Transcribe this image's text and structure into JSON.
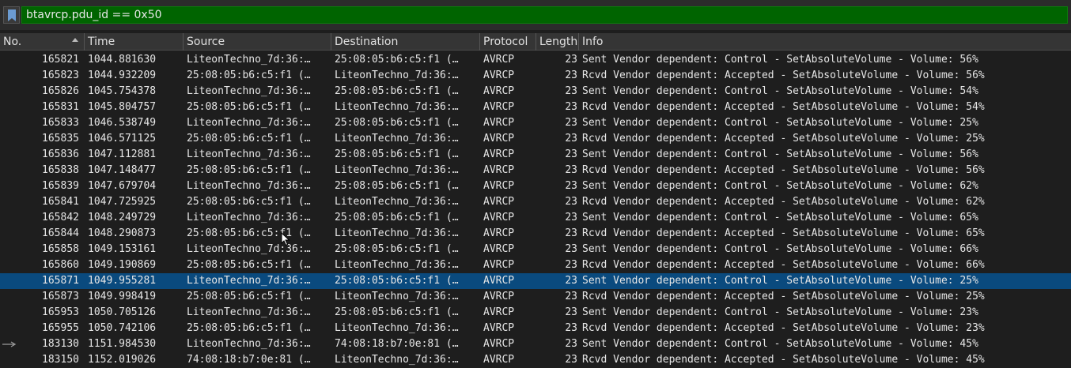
{
  "filter": {
    "value": "btavrcp.pdu_id == 0x50",
    "bookmark_icon": "bookmark-icon"
  },
  "columns": {
    "no": "No.",
    "time": "Time",
    "source": "Source",
    "destination": "Destination",
    "protocol": "Protocol",
    "length": "Length",
    "info": "Info"
  },
  "colors": {
    "filter_valid": "#006400",
    "selected_row": "#0a4a7e",
    "background": "#1e1e1e"
  },
  "packets": [
    {
      "no": "165821",
      "time": "1044.881630",
      "source": "LiteonTechno_7d:36:…",
      "destination": "25:08:05:b6:c5:f1 (…",
      "protocol": "AVRCP",
      "length": "23",
      "info": "Sent Vendor dependent: Control - SetAbsoluteVolume - Volume: 56%"
    },
    {
      "no": "165823",
      "time": "1044.932209",
      "source": "25:08:05:b6:c5:f1 (…",
      "destination": "LiteonTechno_7d:36:…",
      "protocol": "AVRCP",
      "length": "23",
      "info": "Rcvd Vendor dependent: Accepted - SetAbsoluteVolume - Volume: 56%"
    },
    {
      "no": "165826",
      "time": "1045.754378",
      "source": "LiteonTechno_7d:36:…",
      "destination": "25:08:05:b6:c5:f1 (…",
      "protocol": "AVRCP",
      "length": "23",
      "info": "Sent Vendor dependent: Control - SetAbsoluteVolume - Volume: 54%"
    },
    {
      "no": "165831",
      "time": "1045.804757",
      "source": "25:08:05:b6:c5:f1 (…",
      "destination": "LiteonTechno_7d:36:…",
      "protocol": "AVRCP",
      "length": "23",
      "info": "Rcvd Vendor dependent: Accepted - SetAbsoluteVolume - Volume: 54%"
    },
    {
      "no": "165833",
      "time": "1046.538749",
      "source": "LiteonTechno_7d:36:…",
      "destination": "25:08:05:b6:c5:f1 (…",
      "protocol": "AVRCP",
      "length": "23",
      "info": "Sent Vendor dependent: Control - SetAbsoluteVolume - Volume: 25%"
    },
    {
      "no": "165835",
      "time": "1046.571125",
      "source": "25:08:05:b6:c5:f1 (…",
      "destination": "LiteonTechno_7d:36:…",
      "protocol": "AVRCP",
      "length": "23",
      "info": "Rcvd Vendor dependent: Accepted - SetAbsoluteVolume - Volume: 25%"
    },
    {
      "no": "165836",
      "time": "1047.112881",
      "source": "LiteonTechno_7d:36:…",
      "destination": "25:08:05:b6:c5:f1 (…",
      "protocol": "AVRCP",
      "length": "23",
      "info": "Sent Vendor dependent: Control - SetAbsoluteVolume - Volume: 56%"
    },
    {
      "no": "165838",
      "time": "1047.148477",
      "source": "25:08:05:b6:c5:f1 (…",
      "destination": "LiteonTechno_7d:36:…",
      "protocol": "AVRCP",
      "length": "23",
      "info": "Rcvd Vendor dependent: Accepted - SetAbsoluteVolume - Volume: 56%"
    },
    {
      "no": "165839",
      "time": "1047.679704",
      "source": "LiteonTechno_7d:36:…",
      "destination": "25:08:05:b6:c5:f1 (…",
      "protocol": "AVRCP",
      "length": "23",
      "info": "Sent Vendor dependent: Control - SetAbsoluteVolume - Volume: 62%"
    },
    {
      "no": "165841",
      "time": "1047.725925",
      "source": "25:08:05:b6:c5:f1 (…",
      "destination": "LiteonTechno_7d:36:…",
      "protocol": "AVRCP",
      "length": "23",
      "info": "Rcvd Vendor dependent: Accepted - SetAbsoluteVolume - Volume: 62%"
    },
    {
      "no": "165842",
      "time": "1048.249729",
      "source": "LiteonTechno_7d:36:…",
      "destination": "25:08:05:b6:c5:f1 (…",
      "protocol": "AVRCP",
      "length": "23",
      "info": "Sent Vendor dependent: Control - SetAbsoluteVolume - Volume: 65%"
    },
    {
      "no": "165844",
      "time": "1048.290873",
      "source": "25:08:05:b6:c5:f1 (…",
      "destination": "LiteonTechno_7d:36:…",
      "protocol": "AVRCP",
      "length": "23",
      "info": "Rcvd Vendor dependent: Accepted - SetAbsoluteVolume - Volume: 65%"
    },
    {
      "no": "165858",
      "time": "1049.153161",
      "source": "LiteonTechno_7d:36:…",
      "destination": "25:08:05:b6:c5:f1 (…",
      "protocol": "AVRCP",
      "length": "23",
      "info": "Sent Vendor dependent: Control - SetAbsoluteVolume - Volume: 66%"
    },
    {
      "no": "165860",
      "time": "1049.190869",
      "source": "25:08:05:b6:c5:f1 (…",
      "destination": "LiteonTechno_7d:36:…",
      "protocol": "AVRCP",
      "length": "23",
      "info": "Rcvd Vendor dependent: Accepted - SetAbsoluteVolume - Volume: 66%"
    },
    {
      "no": "165871",
      "time": "1049.955281",
      "source": "LiteonTechno_7d:36:…",
      "destination": "25:08:05:b6:c5:f1 (…",
      "protocol": "AVRCP",
      "length": "23",
      "info": "Sent Vendor dependent: Control - SetAbsoluteVolume - Volume: 25%",
      "selected": true
    },
    {
      "no": "165873",
      "time": "1049.998419",
      "source": "25:08:05:b6:c5:f1 (…",
      "destination": "LiteonTechno_7d:36:…",
      "protocol": "AVRCP",
      "length": "23",
      "info": "Rcvd Vendor dependent: Accepted - SetAbsoluteVolume - Volume: 25%"
    },
    {
      "no": "165953",
      "time": "1050.705126",
      "source": "LiteonTechno_7d:36:…",
      "destination": "25:08:05:b6:c5:f1 (…",
      "protocol": "AVRCP",
      "length": "23",
      "info": "Sent Vendor dependent: Control - SetAbsoluteVolume - Volume: 23%"
    },
    {
      "no": "165955",
      "time": "1050.742106",
      "source": "25:08:05:b6:c5:f1 (…",
      "destination": "LiteonTechno_7d:36:…",
      "protocol": "AVRCP",
      "length": "23",
      "info": "Rcvd Vendor dependent: Accepted - SetAbsoluteVolume - Volume: 23%"
    },
    {
      "no": "183130",
      "time": "1151.984530",
      "source": "LiteonTechno_7d:36:…",
      "destination": "74:08:18:b7:0e:81 (…",
      "protocol": "AVRCP",
      "length": "23",
      "info": "Sent Vendor dependent: Control - SetAbsoluteVolume - Volume: 45%",
      "marker": "arrow-right-icon"
    },
    {
      "no": "183150",
      "time": "1152.019026",
      "source": "74:08:18:b7:0e:81 (…",
      "destination": "LiteonTechno_7d:36:…",
      "protocol": "AVRCP",
      "length": "23",
      "info": "Rcvd Vendor dependent: Accepted - SetAbsoluteVolume - Volume: 45%"
    }
  ]
}
